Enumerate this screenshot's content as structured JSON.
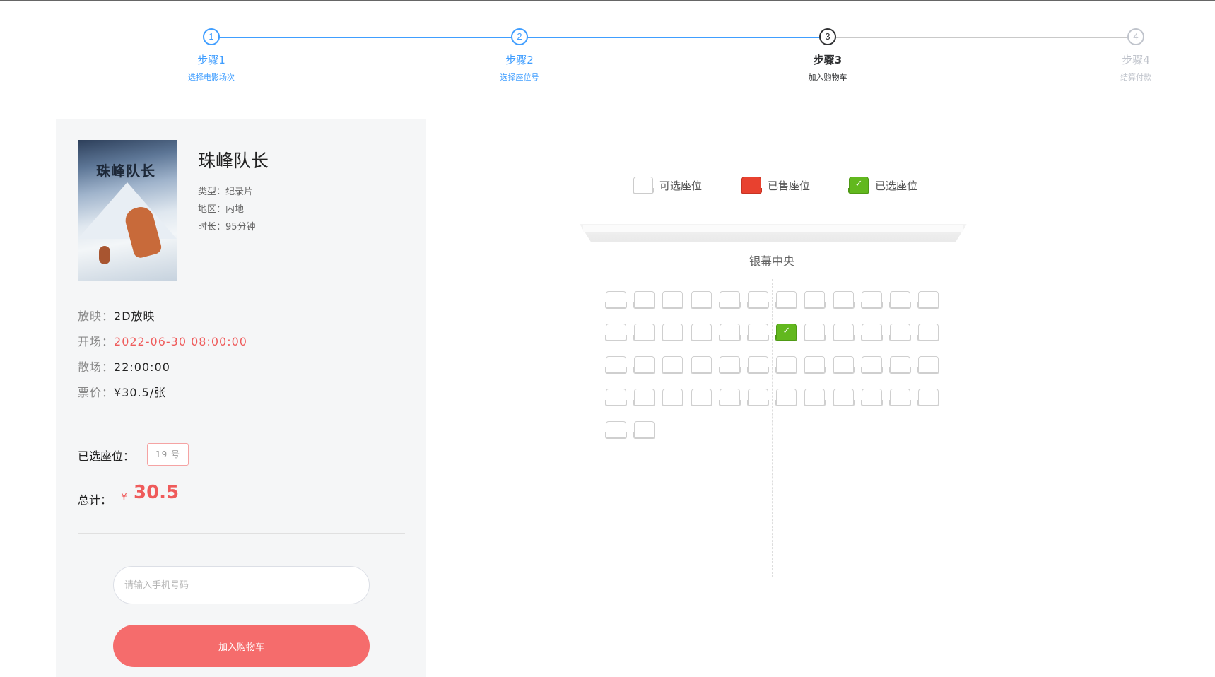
{
  "steps": [
    {
      "num": "1",
      "title": "步骤1",
      "sub": "选择电影场次",
      "state": "done"
    },
    {
      "num": "2",
      "title": "步骤2",
      "sub": "选择座位号",
      "state": "done"
    },
    {
      "num": "3",
      "title": "步骤3",
      "sub": "加入购物车",
      "state": "active"
    },
    {
      "num": "4",
      "title": "步骤4",
      "sub": "结算付款",
      "state": "wait"
    }
  ],
  "movie": {
    "poster_title": "珠峰队长",
    "title": "珠峰队长",
    "type_label": "类型：",
    "type": "纪录片",
    "region_label": "地区：",
    "region": "内地",
    "duration_label": "时长：",
    "duration": "95分钟"
  },
  "schedule": {
    "format_label": "放映：",
    "format": "2D放映",
    "start_label": "开场：",
    "start": "2022-06-30 08:00:00",
    "end_label": "散场：",
    "end": "22:00:00",
    "price_label": "票价：",
    "price": "¥30.5/张"
  },
  "selection": {
    "label": "已选座位：",
    "seats": "19 号",
    "total_label": "总计：",
    "currency": "¥",
    "total": "30.5"
  },
  "form": {
    "phone_placeholder": "请输入手机号码",
    "submit_label": "加入购物车"
  },
  "legend": {
    "available": "可选座位",
    "sold": "已售座位",
    "selected": "已选座位"
  },
  "screen_label": "银幕中央",
  "seat_map": {
    "rows": [
      [
        0,
        0,
        0,
        0,
        0,
        0,
        0,
        0,
        0,
        0,
        0,
        0
      ],
      [
        0,
        0,
        0,
        0,
        0,
        0,
        2,
        0,
        0,
        0,
        0,
        0
      ],
      [
        0,
        0,
        0,
        0,
        0,
        0,
        0,
        0,
        0,
        0,
        0,
        0
      ],
      [
        0,
        0,
        0,
        0,
        0,
        0,
        0,
        0,
        0,
        0,
        0,
        0
      ],
      [
        0,
        0
      ]
    ],
    "state_codes": {
      "0": "available",
      "1": "sold",
      "2": "selected"
    }
  },
  "colors": {
    "primary": "#409eff",
    "accent": "#f56c6c",
    "sold": "#e8412f",
    "selected": "#62b81e"
  }
}
